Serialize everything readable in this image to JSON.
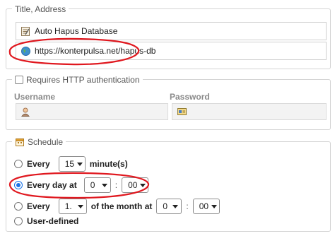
{
  "title_address": {
    "legend": "Title, Address",
    "title_value": "Auto Hapus Database",
    "address_value": "https://konterpulsa.net/hapus-db"
  },
  "http_auth": {
    "legend": "Requires HTTP authentication",
    "username_label": "Username",
    "password_label": "Password",
    "username_value": "",
    "password_value": ""
  },
  "schedule": {
    "legend": "Schedule",
    "every": {
      "label": "Every",
      "value": "15",
      "unit": "minute(s)"
    },
    "every_day": {
      "label": "Every day at",
      "hour": "0",
      "minute": "00",
      "separator": ":"
    },
    "monthly": {
      "label": "Every",
      "day": "1.",
      "middle": "of the month at",
      "hour": "0",
      "minute": "00",
      "separator": ":"
    },
    "user_defined": {
      "label": "User-defined"
    }
  },
  "colors": {
    "annotation": "#e0181f",
    "radio_checked": "#1a73e8"
  },
  "icons": [
    "document-icon",
    "globe-icon",
    "user-icon",
    "key-card-icon",
    "calendar-icon"
  ]
}
